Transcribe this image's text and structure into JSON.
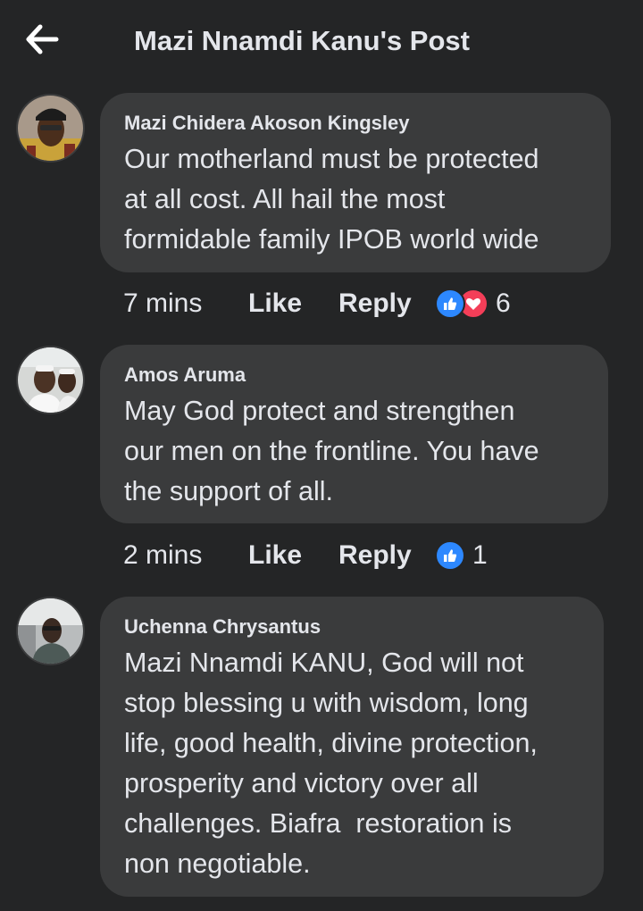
{
  "header": {
    "back_icon": "arrow-left-icon",
    "title": "Mazi Nnamdi Kanu's Post"
  },
  "comments": [
    {
      "author": "Mazi Chidera Akoson Kingsley",
      "lines": [
        "Our motherland must be protected",
        "at all cost. All hail the most",
        "formidable family IPOB world wide"
      ],
      "time": "7 mins",
      "like_label": "Like",
      "reply_label": "Reply",
      "reactions": [
        "like",
        "love"
      ],
      "reaction_count": "6"
    },
    {
      "author": "Amos Aruma",
      "lines": [
        "May God protect and strengthen",
        "our men on the frontline. You have",
        "the support of all."
      ],
      "time": "2 mins",
      "like_label": "Like",
      "reply_label": "Reply",
      "reactions": [
        "like"
      ],
      "reaction_count": "1"
    },
    {
      "author": "Uchenna Chrysantus",
      "lines": [
        "Mazi Nnamdi KANU, God will not",
        "stop blessing u with wisdom, long",
        "life, good health, divine protection,",
        "prosperity and victory over all",
        "challenges. Biafra  restoration is",
        "non negotiable."
      ]
    }
  ],
  "colors": {
    "background": "#242526",
    "bubble": "#3a3b3c",
    "text": "#e4e6eb",
    "like_reaction": "#2d88ff",
    "love_reaction": "#f33e58"
  }
}
